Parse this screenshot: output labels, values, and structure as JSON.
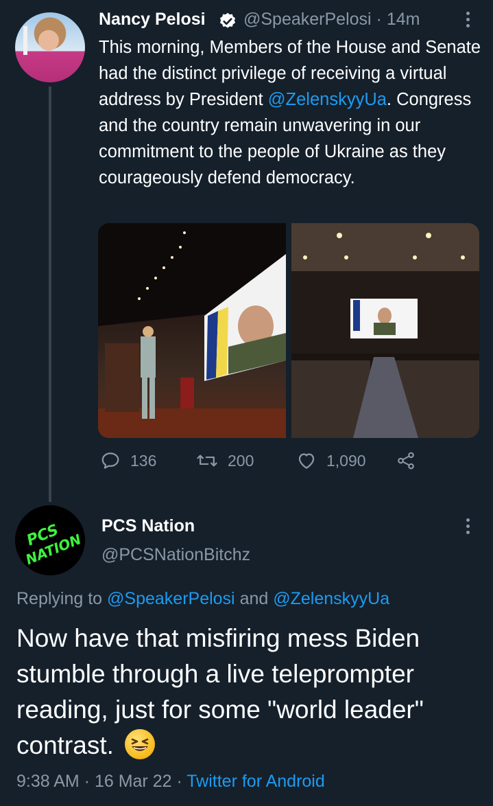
{
  "tweet": {
    "author_name": "Nancy Pelosi",
    "handle": "@SpeakerPelosi",
    "time": "· 14m",
    "text_parts": {
      "before": "This morning, Members of the House and Senate had the distinct privilege of receiving a virtual address by President ",
      "mention": "@ZelenskyyUa",
      "after": ". Congress and the country remain unwavering in our commitment to the people of Ukraine as they courageously defend democracy."
    },
    "actions": {
      "replies": "136",
      "retweets": "200",
      "likes": "1,090"
    }
  },
  "reply": {
    "author_name": "PCS Nation",
    "handle": "@PCSNationBitchz",
    "replying_prefix": "Replying to ",
    "replying_to_1": "@SpeakerPelosi",
    "replying_and": " and ",
    "replying_to_2": "@ZelenskyyUa",
    "text": "Now have that misfiring mess Biden stumble through a live teleprompter reading, just for some \"world leader\" contrast.",
    "timestamp": "9:38 AM · 16 Mar 22 · ",
    "source": "Twitter for Android",
    "logo_text": "PCS NATION"
  },
  "colors": {
    "background": "#15202b",
    "secondary_text": "#8b98a5",
    "link": "#1d9bf0",
    "logo_green": "#3ef23e"
  },
  "icons": [
    "verified-badge-icon",
    "more-options-icon",
    "reply-icon",
    "retweet-icon",
    "like-icon",
    "share-icon",
    "grinning-squinting-face-emoji"
  ]
}
